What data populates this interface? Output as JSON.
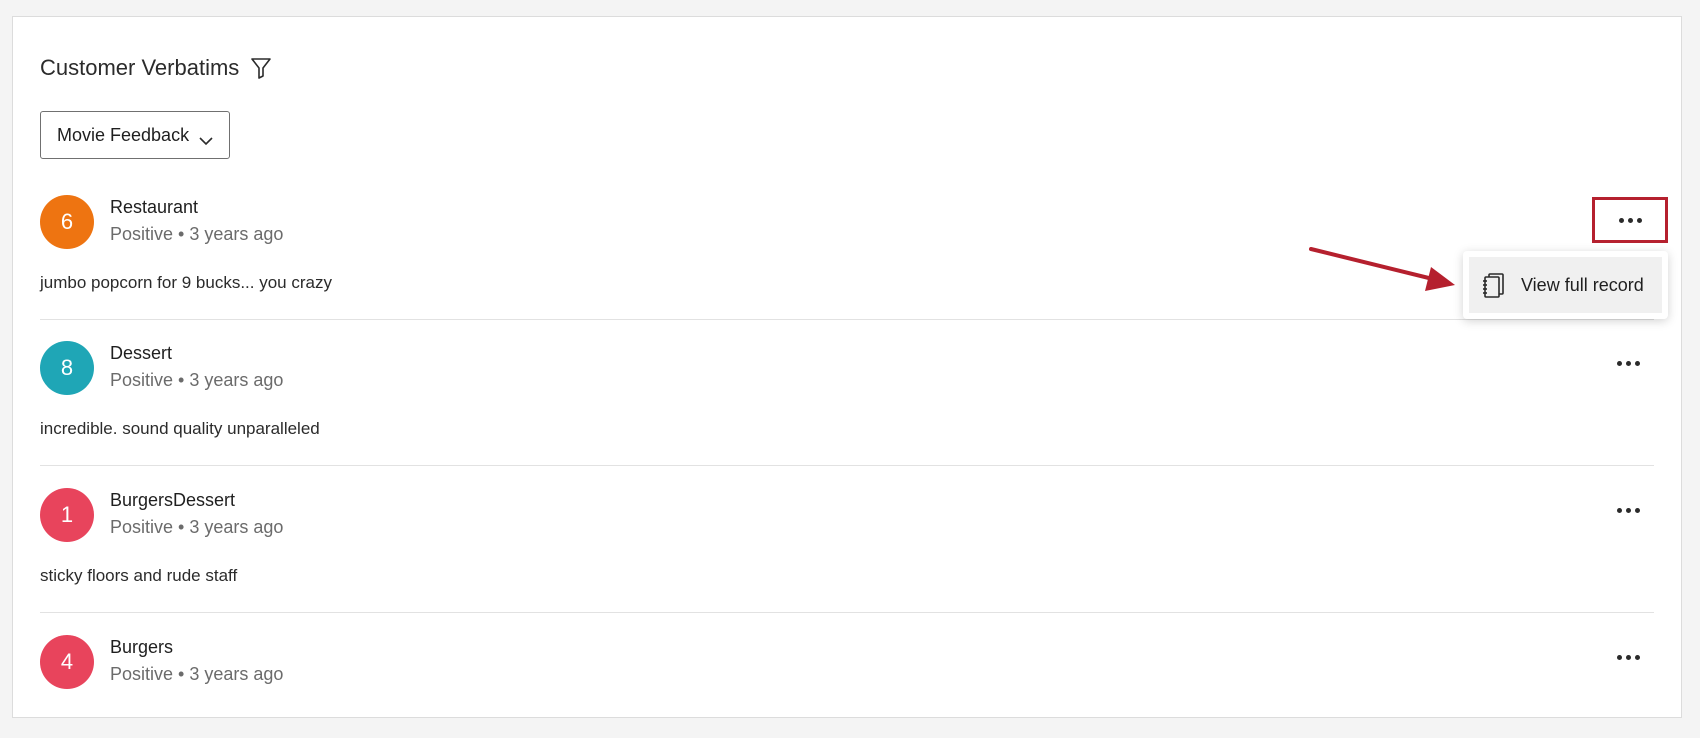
{
  "widget": {
    "title": "Customer Verbatims",
    "filter_icon": "filter-icon"
  },
  "dropdown": {
    "selected": "Movie Feedback"
  },
  "records": [
    {
      "score": "6",
      "score_color": "#ee7411",
      "name": "Restaurant",
      "meta": "Positive • 3 years ago",
      "text": "jumbo popcorn for 9 bucks... you crazy"
    },
    {
      "score": "8",
      "score_color": "#1fa6b6",
      "name": "Dessert",
      "meta": "Positive • 3 years ago",
      "text": "incredible. sound quality unparalleled"
    },
    {
      "score": "1",
      "score_color": "#e8445c",
      "name": "BurgersDessert",
      "meta": "Positive • 3 years ago",
      "text": "sticky floors and rude staff"
    },
    {
      "score": "4",
      "score_color": "#e8445c",
      "name": "Burgers",
      "meta": "Positive • 3 years ago",
      "text": ""
    }
  ],
  "menu": {
    "item_label": "View full record",
    "item_icon": "record-icon"
  },
  "annotation": {
    "highlight_color": "#b5202e"
  }
}
